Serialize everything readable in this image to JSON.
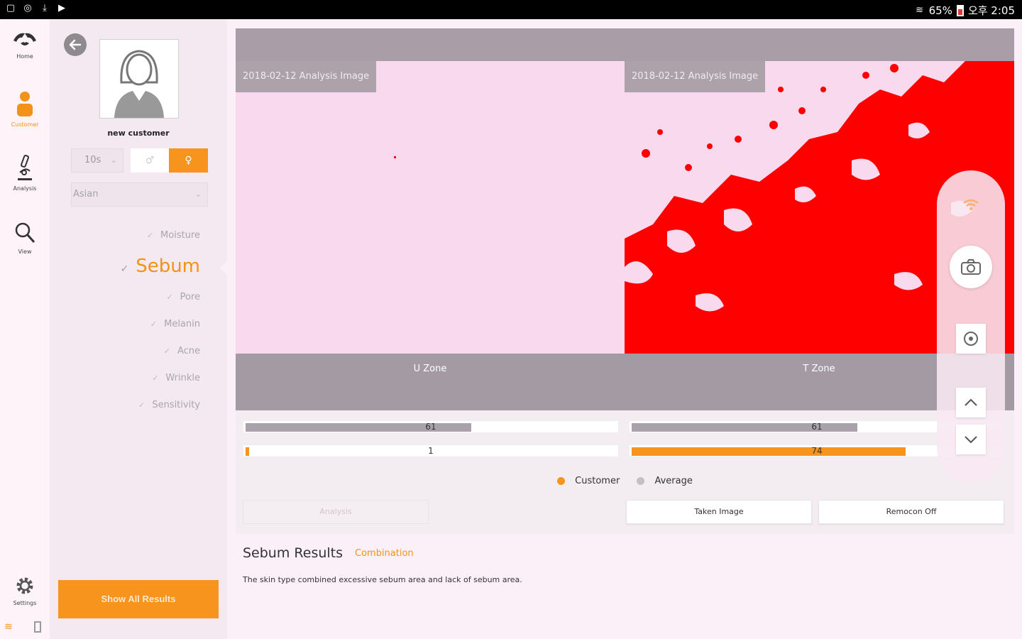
{
  "status_bar": {
    "battery": "65%",
    "time": "오후 2:05"
  },
  "nav": {
    "home": "Home",
    "customer": "Customer",
    "analysis": "Analysis",
    "view": "View",
    "settings": "Settings"
  },
  "customer": {
    "name": "new customer",
    "age": "10s",
    "race": "Asian"
  },
  "menu": {
    "moisture": "Moisture",
    "sebum": "Sebum",
    "pore": "Pore",
    "melanin": "Melanin",
    "acne": "Acne",
    "wrinkle": "Wrinkle",
    "sensitivity": "Sensitivity"
  },
  "show_all_label": "Show All Results",
  "images": {
    "left_label": "2018-02-12 Analysis Image",
    "right_label": "2018-02-12 Analysis Image"
  },
  "zones": {
    "u_zone": "U Zone",
    "t_zone": "T Zone"
  },
  "bars": {
    "u_average": 61,
    "u_customer": 1,
    "t_average": 61,
    "t_customer": 74
  },
  "legend": {
    "customer": "Customer",
    "average": "Average"
  },
  "buttons": {
    "analysis": "Analysis",
    "taken_image": "Taken Image",
    "remocon_off": "Remocon Off"
  },
  "results": {
    "title": "Sebum Results",
    "type": "Combination",
    "description": "The skin type combined excessive sebum area and lack of sebum area."
  },
  "colors": {
    "accent": "#f7941d",
    "average_bar": "#aaa2aa",
    "sebum_red": "#ff0000",
    "image_pink": "#f9d9ee"
  }
}
